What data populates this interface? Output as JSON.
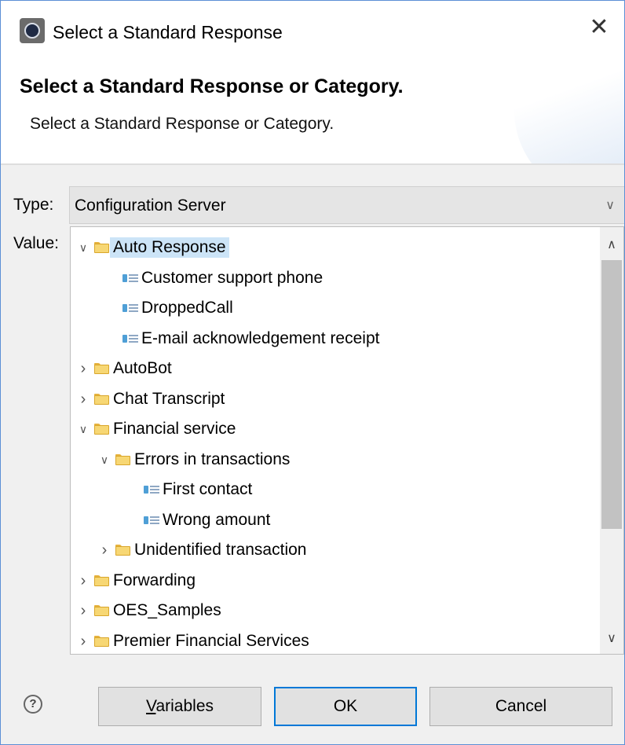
{
  "window": {
    "title": "Select a Standard Response",
    "close_glyph": "✕"
  },
  "header": {
    "title": "Select a Standard Response or Category.",
    "subtitle": "Select a Standard Response or Category."
  },
  "type_field": {
    "label": "Type:",
    "value": "Configuration Server"
  },
  "value_field": {
    "label": "Value:"
  },
  "tree": {
    "items": [
      {
        "label": "Auto Response",
        "kind": "folder",
        "level": 0,
        "expanded": true,
        "selected": true
      },
      {
        "label": "Customer support phone",
        "kind": "response",
        "level": 1
      },
      {
        "label": "DroppedCall",
        "kind": "response",
        "level": 1
      },
      {
        "label": "E-mail acknowledgement receipt",
        "kind": "response",
        "level": 1
      },
      {
        "label": "AutoBot",
        "kind": "folder",
        "level": 0,
        "expanded": false
      },
      {
        "label": "Chat Transcript",
        "kind": "folder",
        "level": 0,
        "expanded": false
      },
      {
        "label": "Financial service",
        "kind": "folder",
        "level": 0,
        "expanded": true
      },
      {
        "label": "Errors in transactions",
        "kind": "folder",
        "level": 1,
        "expanded": true
      },
      {
        "label": "First contact",
        "kind": "response",
        "level": 2
      },
      {
        "label": "Wrong amount",
        "kind": "response",
        "level": 2
      },
      {
        "label": "Unidentified transaction",
        "kind": "folder",
        "level": 1,
        "expanded": false
      },
      {
        "label": "Forwarding",
        "kind": "folder",
        "level": 0,
        "expanded": false
      },
      {
        "label": "OES_Samples",
        "kind": "folder",
        "level": 0,
        "expanded": false
      },
      {
        "label": "Premier Financial Services",
        "kind": "folder",
        "level": 0,
        "expanded": false
      }
    ]
  },
  "footer": {
    "help_glyph": "?",
    "variables_mnemonic": "V",
    "variables_rest": "ariables",
    "ok_label": "OK",
    "cancel_label": "Cancel"
  },
  "icons": {
    "app": "eclipse-app-icon",
    "folder": "folder-icon",
    "response": "standard-response-icon"
  },
  "colors": {
    "selection": "#cce4f7",
    "default_button_border": "#0078d7",
    "window_border": "#5b8fd6"
  }
}
